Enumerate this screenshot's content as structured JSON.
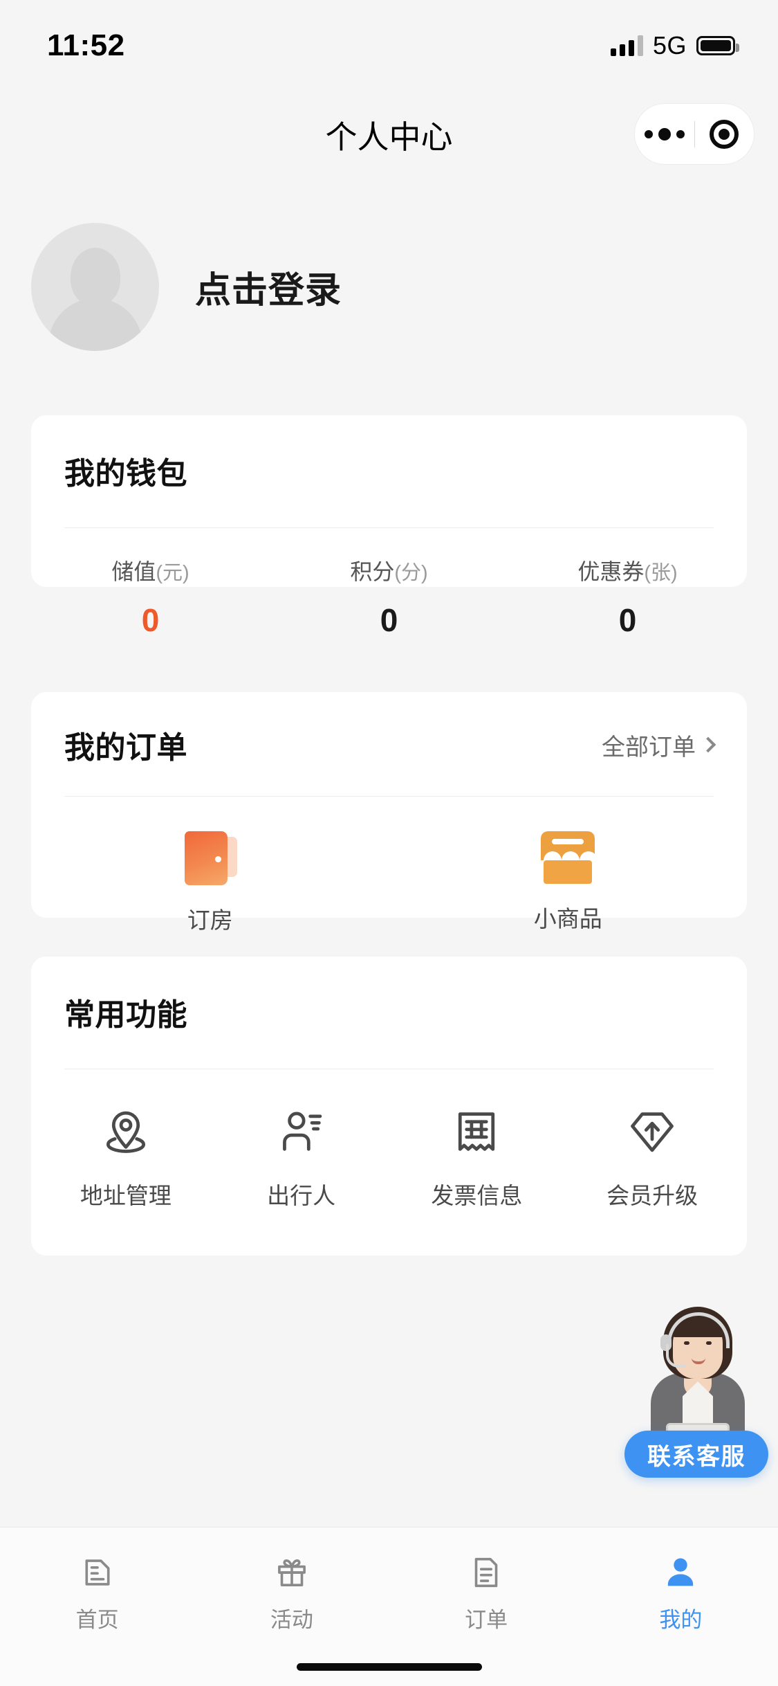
{
  "status_bar": {
    "time": "11:52",
    "network": "5G",
    "signal_icon": "signal-bars-icon",
    "battery_icon": "battery-icon"
  },
  "nav": {
    "title": "个人中心",
    "capsule": {
      "more_icon": "ellipsis-icon",
      "target_icon": "target-circle-icon"
    }
  },
  "profile": {
    "avatar_icon": "default-avatar-icon",
    "login_label": "点击登录"
  },
  "wallet": {
    "title": "我的钱包",
    "stats": [
      {
        "label": "储值",
        "unit": "(元)",
        "value": "0",
        "accent": true
      },
      {
        "label": "积分",
        "unit": "(分)",
        "value": "0",
        "accent": false
      },
      {
        "label": "优惠券",
        "unit": "(张)",
        "value": "0",
        "accent": false
      }
    ]
  },
  "orders": {
    "title": "我的订单",
    "all_orders_label": "全部订单",
    "chevron_icon": "chevron-right-icon",
    "items": [
      {
        "label": "订房",
        "icon": "door-icon"
      },
      {
        "label": "小商品",
        "icon": "shop-icon"
      }
    ]
  },
  "functions": {
    "title": "常用功能",
    "items": [
      {
        "label": "地址管理",
        "icon": "location-pin-icon"
      },
      {
        "label": "出行人",
        "icon": "traveler-person-icon"
      },
      {
        "label": "发票信息",
        "icon": "invoice-receipt-icon"
      },
      {
        "label": "会员升级",
        "icon": "diamond-upgrade-icon"
      }
    ]
  },
  "customer_service": {
    "button_label": "联系客服",
    "avatar_icon": "headset-agent-icon"
  },
  "tabbar": {
    "items": [
      {
        "label": "首页",
        "icon": "home-icon",
        "active": false
      },
      {
        "label": "活动",
        "icon": "gift-icon",
        "active": false
      },
      {
        "label": "订单",
        "icon": "order-list-icon",
        "active": false
      },
      {
        "label": "我的",
        "icon": "user-icon",
        "active": true
      }
    ]
  },
  "colors": {
    "page_bg": "#f5f5f5",
    "card_bg": "#ffffff",
    "accent_orange": "#ef5a2b",
    "accent_blue": "#3d92f2",
    "icon_gray": "#4a4a4a"
  }
}
